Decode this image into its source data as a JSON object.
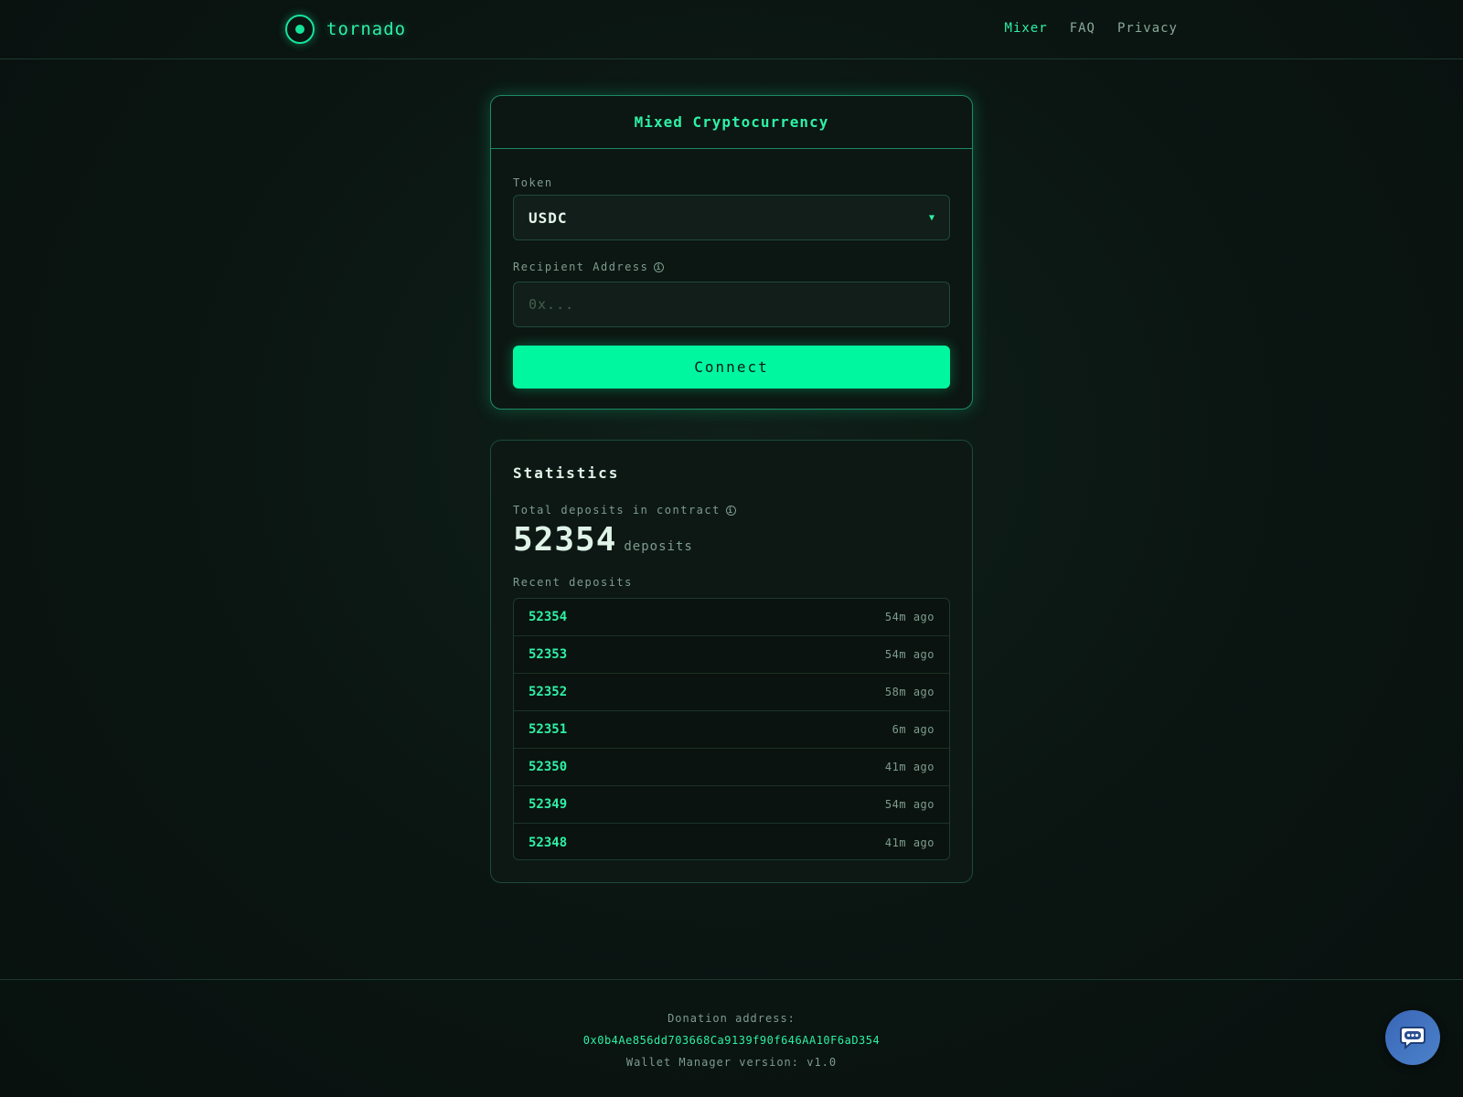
{
  "brand": {
    "name": "tornado"
  },
  "nav": {
    "items": [
      "Mixer",
      "FAQ",
      "Privacy"
    ]
  },
  "mixer": {
    "title": "Mixed Cryptocurrency",
    "token_label": "Token",
    "token_value": "USDC",
    "recipient_label": "Recipient Address",
    "recipient_placeholder": "0x...",
    "recipient_value": "",
    "connect_label": "Connect"
  },
  "stats": {
    "title": "Statistics",
    "total_label": "Total deposits in contract",
    "total_value": "52354",
    "total_unit": "deposits",
    "recent_label": "Recent deposits",
    "recent": [
      {
        "id": "52354",
        "time": "54m ago"
      },
      {
        "id": "52353",
        "time": "54m ago"
      },
      {
        "id": "52352",
        "time": "58m ago"
      },
      {
        "id": "52351",
        "time": "6m ago"
      },
      {
        "id": "52350",
        "time": "41m ago"
      },
      {
        "id": "52349",
        "time": "54m ago"
      },
      {
        "id": "52348",
        "time": "41m ago"
      }
    ]
  },
  "footer": {
    "donation_label": "Donation address:",
    "donation_address": "0x0b4Ae856dd703668Ca9139f90f646AA10F6aD354",
    "version": "Wallet Manager version: v1.0"
  },
  "icons": {
    "logo": "radio-target-icon",
    "info": "info-icon",
    "chevron": "chevron-down-icon",
    "chat": "chat-bubble-icon"
  },
  "colors": {
    "accent": "#00f7a0",
    "background": "#0a1411",
    "chat": "#4b82c9"
  }
}
